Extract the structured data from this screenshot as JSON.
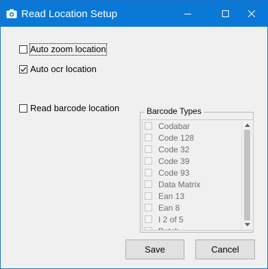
{
  "window": {
    "title": "Read Location Setup",
    "controls": {
      "minimize": "minimize",
      "maximize": "maximize",
      "close": "close"
    },
    "accent": "#0a78d7"
  },
  "options": {
    "auto_zoom": {
      "label": "Auto zoom location",
      "checked": false
    },
    "auto_ocr": {
      "label": "Auto ocr location",
      "checked": true
    },
    "read_barcode": {
      "label": "Read barcode location",
      "checked": false
    }
  },
  "barcode_types": {
    "title": "Barcode Types",
    "items": [
      "Codabar",
      "Code 128",
      "Code 32",
      "Code 39",
      "Code 93",
      "Data Matrix",
      "Ean 13",
      "Ean 8",
      "I 2 of 5",
      "Patch"
    ]
  },
  "buttons": {
    "save": "Save",
    "cancel": "Cancel"
  }
}
